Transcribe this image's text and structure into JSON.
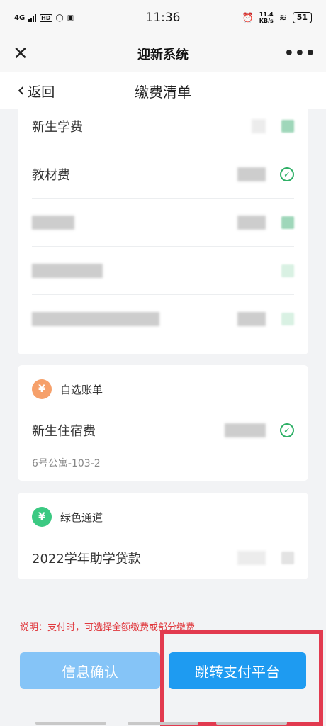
{
  "status_bar": {
    "network": "4G",
    "hd": "HD",
    "time": "11:36",
    "speed_value": "11.4",
    "speed_unit": "KB/s",
    "battery": "51"
  },
  "app_bar": {
    "title": "迎新系统",
    "close_icon": "close-icon",
    "more_icon": "more-icon",
    "more_glyph": "•••"
  },
  "nav_bar": {
    "back_label": "返回",
    "title": "缴费清单"
  },
  "card_required": {
    "items": [
      {
        "label": "新生学费"
      },
      {
        "label": "教材费"
      }
    ]
  },
  "card_optional": {
    "header": "自选账单",
    "icon": "money-bag-icon",
    "item_label": "新生住宿费",
    "item_detail": "6号公寓-103-2"
  },
  "card_green": {
    "header": "绿色通道",
    "icon": "money-bag-icon",
    "item_label": "2022学年助学贷款"
  },
  "note": "说明：支付时，可选择全额缴费或部分缴费",
  "buttons": {
    "confirm": "信息确认",
    "pay": "跳转支付平台"
  },
  "colors": {
    "primary": "#1e9bf1",
    "primary_light": "#85c4f7",
    "success": "#2fb067",
    "warning_note": "#e0393e",
    "highlight_box": "#e23a4f"
  }
}
